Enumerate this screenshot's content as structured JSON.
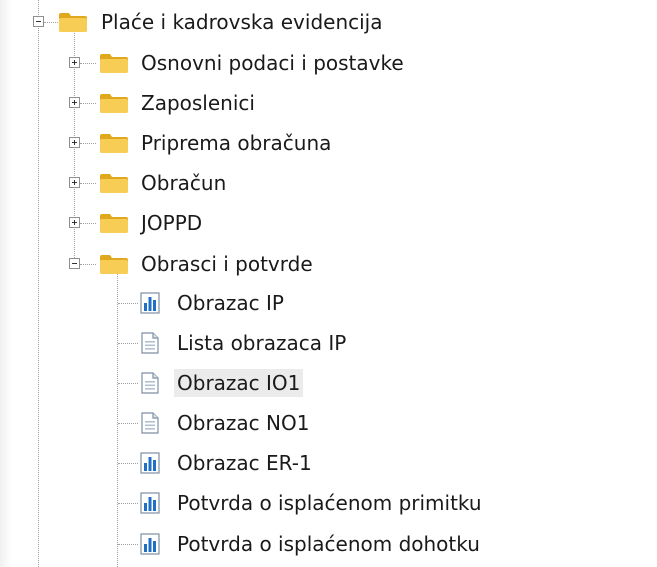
{
  "tree": {
    "root": {
      "label": "Plaće i kadrovska evidencija",
      "icon": "folder-icon",
      "expanded": true
    },
    "children": [
      {
        "label": "Osnovni podaci i postavke",
        "icon": "folder-icon",
        "expanded": false
      },
      {
        "label": "Zaposlenici",
        "icon": "folder-icon",
        "expanded": false
      },
      {
        "label": "Priprema obračuna",
        "icon": "folder-icon",
        "expanded": false
      },
      {
        "label": "Obračun",
        "icon": "folder-icon",
        "expanded": false
      },
      {
        "label": "JOPPD",
        "icon": "folder-icon",
        "expanded": false
      },
      {
        "label": "Obrasci i potvrde",
        "icon": "folder-icon",
        "expanded": true
      }
    ],
    "obrasci_items": [
      {
        "label": "Obrazac IP",
        "icon": "report-chart-icon"
      },
      {
        "label": "Lista obrazaca IP",
        "icon": "document-icon"
      },
      {
        "label": "Obrazac IO1",
        "icon": "document-icon",
        "selected": true
      },
      {
        "label": "Obrazac NO1",
        "icon": "document-icon"
      },
      {
        "label": "Obrazac ER-1",
        "icon": "report-chart-icon"
      },
      {
        "label": "Potvrda o isplaćenom primitku",
        "icon": "report-chart-icon"
      },
      {
        "label": "Potvrda o isplaćenom dohotku",
        "icon": "report-chart-icon"
      }
    ]
  },
  "colors": {
    "folder": "#f5c542",
    "folder_dark": "#e0a81c",
    "chart_blue": "#1f6fc5",
    "selection": "#ebebeb"
  }
}
